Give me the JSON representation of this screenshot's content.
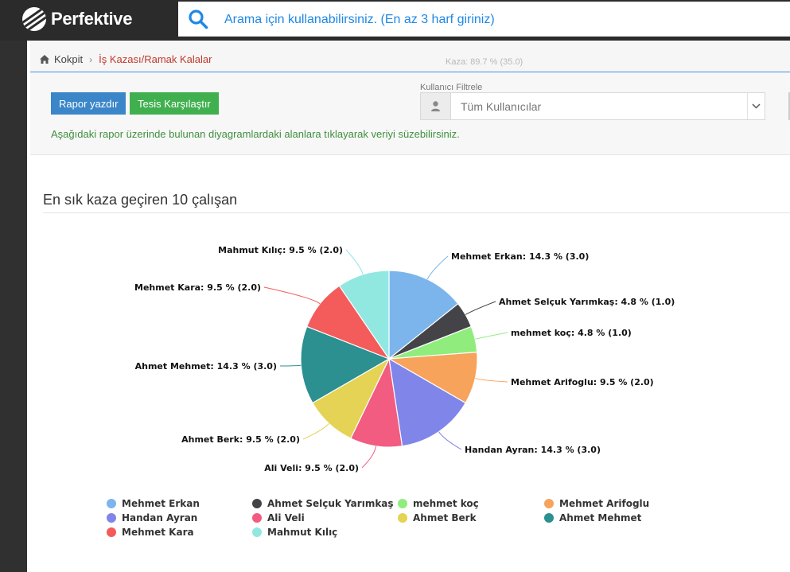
{
  "app": {
    "brand": "Perfektive"
  },
  "search": {
    "placeholder": "Arama için kullanabilirsiniz. (En az 3 harf giriniz)"
  },
  "breadcrumb": {
    "home": "Kokpit",
    "current": "İş Kazası/Ramak Kalalar",
    "ghost": "Kaza: 89.7 % (35.0)"
  },
  "toolbar": {
    "print_label": "Rapor yazdır",
    "compare_label": "Tesis Karşılaştır",
    "info_text": "Aşağıdaki rapor üzerinde bulunan diyagramlardaki alanlara tıklayarak veriyi süzebilirsiniz."
  },
  "filter": {
    "label": "Kullanıcı Filtrele",
    "selected": "Tüm Kullanıcılar"
  },
  "colors": {
    "brand_dark": "#2b2b2b",
    "accent_blue": "#3a86c8",
    "accent_green": "#40b04f",
    "breadcrumb_active": "#c0392b"
  },
  "icons": [
    "search-icon",
    "home-icon",
    "user-icon",
    "chevron-down-icon"
  ],
  "section": {
    "title": "En sık kaza geçiren 10 çalışan"
  },
  "chart_data": {
    "type": "pie",
    "title": "En sık kaza geçiren 10 çalışan",
    "categories": [
      "Mehmet Erkan",
      "Ahmet Selçuk Yarımkaş",
      "mehmet koç",
      "Mehmet Arifoglu",
      "Handan Ayran",
      "Ali Veli",
      "Ahmet Berk",
      "Ahmet Mehmet",
      "Mehmet Kara",
      "Mahmut Kılıç"
    ],
    "values": [
      3.0,
      1.0,
      1.0,
      2.0,
      3.0,
      2.0,
      2.0,
      3.0,
      2.0,
      2.0
    ],
    "percentages": [
      14.3,
      4.8,
      4.8,
      9.5,
      14.3,
      9.5,
      9.5,
      14.3,
      9.5,
      9.5
    ],
    "labels": [
      "Mehmet Erkan: 14.3 % (3.0)",
      "Ahmet Selçuk Yarımkaş: 4.8 % (1.0)",
      "mehmet koç: 4.8 % (1.0)",
      "Mehmet Arifoglu: 9.5 % (2.0)",
      "Handan Ayran: 14.3 % (3.0)",
      "Ali Veli: 9.5 % (2.0)",
      "Ahmet Berk: 9.5 % (2.0)",
      "Ahmet Mehmet: 14.3 % (3.0)",
      "Mehmet Kara: 9.5 % (2.0)",
      "Mahmut Kılıç: 9.5 % (2.0)"
    ],
    "colors": [
      "#7cb5ec",
      "#434348",
      "#90ed7d",
      "#f7a35c",
      "#8085e9",
      "#f15c80",
      "#e4d354",
      "#2b908f",
      "#f45b5b",
      "#91e8e1"
    ],
    "legend": "bottom"
  }
}
